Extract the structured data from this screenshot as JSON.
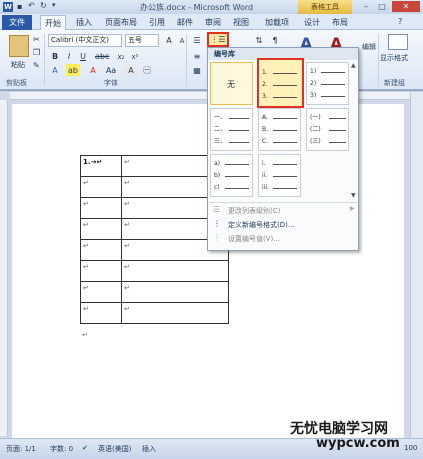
{
  "window": {
    "title": "办公族.docx - Microsoft Word",
    "contextual_tab": "表格工具",
    "controls": {
      "minimize": "–",
      "maximize": "□",
      "close": "✕"
    }
  },
  "tabs": [
    {
      "label": "文件"
    },
    {
      "label": "开始"
    },
    {
      "label": "插入"
    },
    {
      "label": "页面布局"
    },
    {
      "label": "引用"
    },
    {
      "label": "邮件"
    },
    {
      "label": "审阅"
    },
    {
      "label": "视图"
    },
    {
      "label": "加载项"
    },
    {
      "label": "设计"
    },
    {
      "label": "布局"
    }
  ],
  "ribbon": {
    "paste_label": "粘贴",
    "font_name": "Calibri (中文正文)",
    "font_size": "五号",
    "groups": {
      "clipboard": "剪贴板",
      "font": "字体",
      "edit": "编辑",
      "new_group": "新建组"
    },
    "show_format_label": "显示格式",
    "edit_label": "编辑"
  },
  "numbering": {
    "library_title": "编号库",
    "none_label": "无",
    "tiles": [
      [
        "1.",
        "2.",
        "3."
      ],
      [
        "1)",
        "2)",
        "3)"
      ],
      [
        "一、",
        "二、",
        "三、"
      ],
      [
        "A.",
        "B.",
        "C."
      ],
      [
        "(一)",
        "(二)",
        "(三)"
      ],
      [
        "a)",
        "b)",
        "c)"
      ],
      [
        "i.",
        "ii.",
        "iii."
      ]
    ],
    "menu": {
      "change_level": "更改列表级别(C)",
      "define_new": "定义新编号格式(D)...",
      "set_value": "设置编号值(V)..."
    }
  },
  "document": {
    "first_cell": "1.→↵",
    "cell_mark": "↵"
  },
  "status": {
    "page": "页面: 1/1",
    "words": "字数: 0",
    "language": "英语(美国)",
    "mode": "插入",
    "zoom": "100"
  },
  "watermark": {
    "main": "无忧电脑学习网",
    "url": "wypcw.com"
  }
}
